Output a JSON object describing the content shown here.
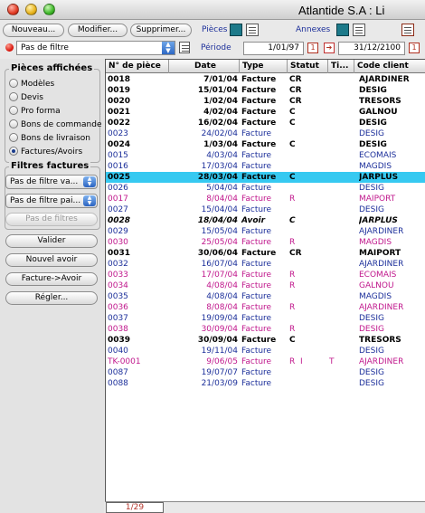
{
  "window": {
    "title": "Atlantide S.A : Li"
  },
  "toolbar": {
    "new_label": "Nouveau...",
    "modify_label": "Modifier...",
    "delete_label": "Supprimer...",
    "pieces_label": "Pièces",
    "annexes_label": "Annexes",
    "filter_select_value": "Pas de filtre",
    "period_label": "Période",
    "period_start": "1/01/97",
    "period_end": "31/12/2100"
  },
  "left": {
    "pieces_title": "Pièces affichées",
    "radios": [
      {
        "label": "Modèles",
        "checked": false
      },
      {
        "label": "Devis",
        "checked": false
      },
      {
        "label": "Pro forma",
        "checked": false
      },
      {
        "label": "Bons de commande",
        "checked": false
      },
      {
        "label": "Bons de livraison",
        "checked": false
      },
      {
        "label": "Factures/Avoirs",
        "checked": true
      }
    ],
    "filters_title": "Filtres factures",
    "filter1": "Pas de filtre va...",
    "filter2": "Pas de filtre pai...",
    "no_filter_btn": "Pas de filtres",
    "validate_btn": "Valider",
    "new_credit_btn": "Nouvel avoir",
    "invoice_to_credit_btn": "Facture->Avoir",
    "settle_btn": "Régler..."
  },
  "table": {
    "columns": [
      "N° de pièce",
      "Date",
      "Type",
      "Statut",
      "Ti...",
      "Code client"
    ],
    "rows": [
      {
        "num": "0018",
        "date": "7/01/04",
        "type": "Facture",
        "statut": "CR",
        "ti": "",
        "client": "AJARDINER",
        "style": "bold"
      },
      {
        "num": "0019",
        "date": "15/01/04",
        "type": "Facture",
        "statut": "CR",
        "ti": "",
        "client": "DESIG",
        "style": "bold"
      },
      {
        "num": "0020",
        "date": "1/02/04",
        "type": "Facture",
        "statut": "CR",
        "ti": "",
        "client": "TRESORS",
        "style": "bold"
      },
      {
        "num": "0021",
        "date": "4/02/04",
        "type": "Facture",
        "statut": "C",
        "ti": "",
        "client": "GALNOU",
        "style": "bold"
      },
      {
        "num": "0022",
        "date": "16/02/04",
        "type": "Facture",
        "statut": "C",
        "ti": "",
        "client": "DESIG",
        "style": "bold"
      },
      {
        "num": "0023",
        "date": "24/02/04",
        "type": "Facture",
        "statut": "",
        "ti": "",
        "client": "DESIG",
        "style": "blue"
      },
      {
        "num": "0024",
        "date": "1/03/04",
        "type": "Facture",
        "statut": "C",
        "ti": "",
        "client": "DESIG",
        "style": "bold"
      },
      {
        "num": "0015",
        "date": "4/03/04",
        "type": "Facture",
        "statut": "",
        "ti": "",
        "client": "ECOMAIS",
        "style": "blue"
      },
      {
        "num": "0016",
        "date": "17/03/04",
        "type": "Facture",
        "statut": "",
        "ti": "",
        "client": "MAGDIS",
        "style": "blue"
      },
      {
        "num": "0025",
        "date": "28/03/04",
        "type": "Facture",
        "statut": "C",
        "ti": "",
        "client": "JARPLUS",
        "style": "bold",
        "selected": true
      },
      {
        "num": "0026",
        "date": "5/04/04",
        "type": "Facture",
        "statut": "",
        "ti": "",
        "client": "DESIG",
        "style": "blue"
      },
      {
        "num": "0017",
        "date": "8/04/04",
        "type": "Facture",
        "statut": "R",
        "ti": "",
        "client": "MAIPORT",
        "style": "pink"
      },
      {
        "num": "0027",
        "date": "15/04/04",
        "type": "Facture",
        "statut": "",
        "ti": "",
        "client": "DESIG",
        "style": "blue"
      },
      {
        "num": "0028",
        "date": "18/04/04",
        "type": "Avoir",
        "statut": "C",
        "ti": "",
        "client": "JARPLUS",
        "style": "bolditalic"
      },
      {
        "num": "0029",
        "date": "15/05/04",
        "type": "Facture",
        "statut": "",
        "ti": "",
        "client": "AJARDINER",
        "style": "blue"
      },
      {
        "num": "0030",
        "date": "25/05/04",
        "type": "Facture",
        "statut": "R",
        "ti": "",
        "client": "MAGDIS",
        "style": "pink"
      },
      {
        "num": "0031",
        "date": "30/06/04",
        "type": "Facture",
        "statut": "CR",
        "ti": "",
        "client": "MAIPORT",
        "style": "bold"
      },
      {
        "num": "0032",
        "date": "16/07/04",
        "type": "Facture",
        "statut": "",
        "ti": "",
        "client": "AJARDINER",
        "style": "blue"
      },
      {
        "num": "0033",
        "date": "17/07/04",
        "type": "Facture",
        "statut": "R",
        "ti": "",
        "client": "ECOMAIS",
        "style": "pink"
      },
      {
        "num": "0034",
        "date": "4/08/04",
        "type": "Facture",
        "statut": "R",
        "ti": "",
        "client": "GALNOU",
        "style": "pink"
      },
      {
        "num": "0035",
        "date": "4/08/04",
        "type": "Facture",
        "statut": "",
        "ti": "",
        "client": "MAGDIS",
        "style": "blue"
      },
      {
        "num": "0036",
        "date": "8/08/04",
        "type": "Facture",
        "statut": "R",
        "ti": "",
        "client": "AJARDINER",
        "style": "pink"
      },
      {
        "num": "0037",
        "date": "19/09/04",
        "type": "Facture",
        "statut": "",
        "ti": "",
        "client": "DESIG",
        "style": "blue"
      },
      {
        "num": "0038",
        "date": "30/09/04",
        "type": "Facture",
        "statut": "R",
        "ti": "",
        "client": "DESIG",
        "style": "pink"
      },
      {
        "num": "0039",
        "date": "30/09/04",
        "type": "Facture",
        "statut": "C",
        "ti": "",
        "client": "TRESORS",
        "style": "bold"
      },
      {
        "num": "0040",
        "date": "19/11/04",
        "type": "Facture",
        "statut": "",
        "ti": "",
        "client": "DESIG",
        "style": "blue"
      },
      {
        "num": "TK-0001",
        "date": "9/06/05",
        "type": "Facture",
        "statut": "R  I",
        "ti": "T",
        "client": "AJARDINER",
        "style": "pink"
      },
      {
        "num": "0087",
        "date": "19/07/07",
        "type": "Facture",
        "statut": "",
        "ti": "",
        "client": "DESIG",
        "style": "blue"
      },
      {
        "num": "0088",
        "date": "21/03/09",
        "type": "Facture",
        "statut": "",
        "ti": "",
        "client": "DESIG",
        "style": "blue"
      }
    ],
    "counter": "1/29"
  },
  "colors": {
    "blue": "#1c2f9a",
    "pink": "#c0178c",
    "selected": "#36c9f1",
    "bold": "#000000"
  }
}
